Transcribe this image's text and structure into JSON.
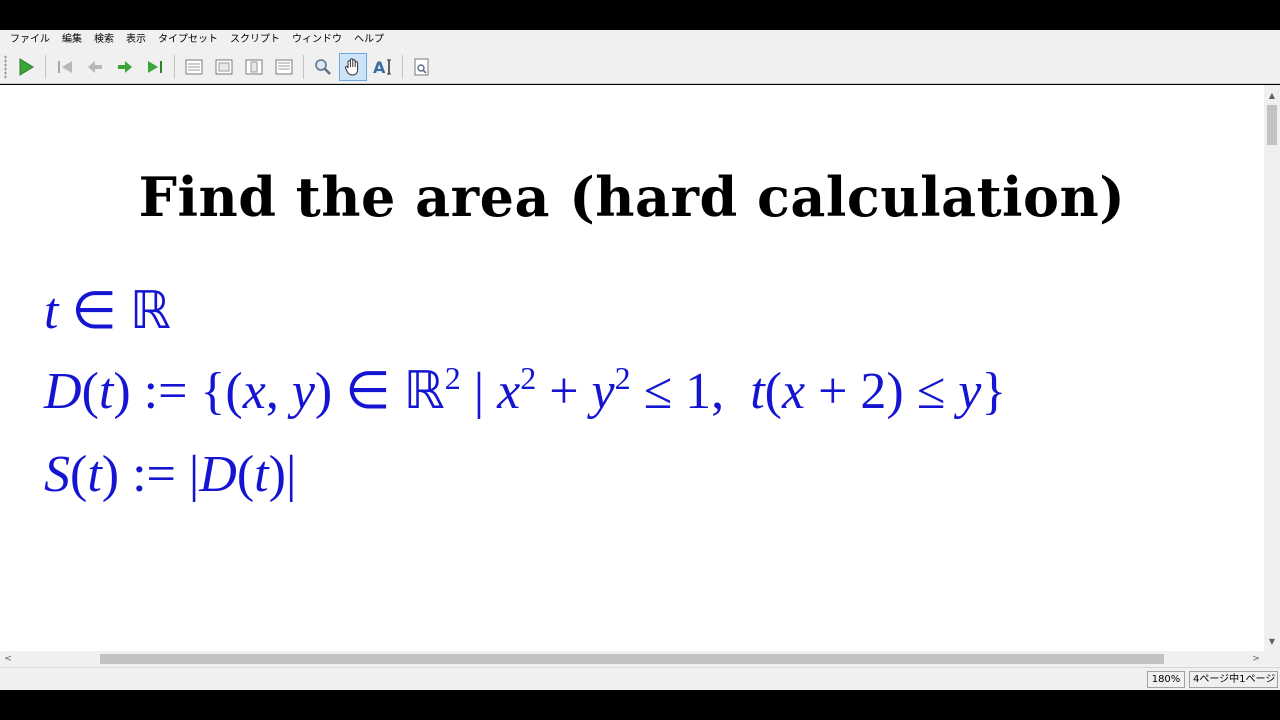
{
  "menu": {
    "items": [
      "ファイル",
      "編集",
      "検索",
      "表示",
      "タイプセット",
      "スクリプト",
      "ウィンドウ",
      "ヘルプ"
    ]
  },
  "toolbar": {
    "buttons": [
      "play-icon",
      "first-page-icon",
      "prev-page-icon",
      "next-page-icon",
      "last-page-icon",
      "single-page-icon",
      "double-page-icon",
      "fit-page-icon",
      "fit-width-icon",
      "magnifier-icon",
      "hand-tool-icon",
      "text-select-icon",
      "search-document-icon"
    ],
    "active": "hand-tool-icon",
    "accent_green": "#3aa63a"
  },
  "document": {
    "title": "Find the area (hard calculation)",
    "text_color": "#1414d2",
    "lines": [
      "t ∈ ℝ",
      "D(t) := {(x, y) ∈ ℝ² | x² + y² ≤ 1,  t(x + 2) ≤ y}",
      "S(t) := |D(t)|"
    ]
  },
  "status": {
    "zoom": "180%",
    "page": "4ページ中1ページ"
  }
}
